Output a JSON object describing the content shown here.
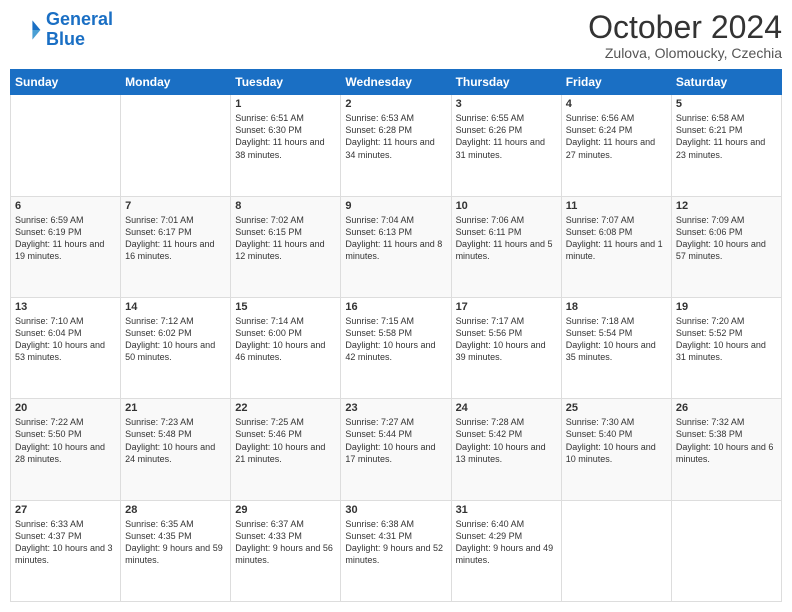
{
  "header": {
    "logo_line1": "General",
    "logo_line2": "Blue",
    "month": "October 2024",
    "location": "Zulova, Olomoucky, Czechia"
  },
  "days_of_week": [
    "Sunday",
    "Monday",
    "Tuesday",
    "Wednesday",
    "Thursday",
    "Friday",
    "Saturday"
  ],
  "weeks": [
    [
      {
        "day": "",
        "info": ""
      },
      {
        "day": "",
        "info": ""
      },
      {
        "day": "1",
        "info": "Sunrise: 6:51 AM\nSunset: 6:30 PM\nDaylight: 11 hours and 38 minutes."
      },
      {
        "day": "2",
        "info": "Sunrise: 6:53 AM\nSunset: 6:28 PM\nDaylight: 11 hours and 34 minutes."
      },
      {
        "day": "3",
        "info": "Sunrise: 6:55 AM\nSunset: 6:26 PM\nDaylight: 11 hours and 31 minutes."
      },
      {
        "day": "4",
        "info": "Sunrise: 6:56 AM\nSunset: 6:24 PM\nDaylight: 11 hours and 27 minutes."
      },
      {
        "day": "5",
        "info": "Sunrise: 6:58 AM\nSunset: 6:21 PM\nDaylight: 11 hours and 23 minutes."
      }
    ],
    [
      {
        "day": "6",
        "info": "Sunrise: 6:59 AM\nSunset: 6:19 PM\nDaylight: 11 hours and 19 minutes."
      },
      {
        "day": "7",
        "info": "Sunrise: 7:01 AM\nSunset: 6:17 PM\nDaylight: 11 hours and 16 minutes."
      },
      {
        "day": "8",
        "info": "Sunrise: 7:02 AM\nSunset: 6:15 PM\nDaylight: 11 hours and 12 minutes."
      },
      {
        "day": "9",
        "info": "Sunrise: 7:04 AM\nSunset: 6:13 PM\nDaylight: 11 hours and 8 minutes."
      },
      {
        "day": "10",
        "info": "Sunrise: 7:06 AM\nSunset: 6:11 PM\nDaylight: 11 hours and 5 minutes."
      },
      {
        "day": "11",
        "info": "Sunrise: 7:07 AM\nSunset: 6:08 PM\nDaylight: 11 hours and 1 minute."
      },
      {
        "day": "12",
        "info": "Sunrise: 7:09 AM\nSunset: 6:06 PM\nDaylight: 10 hours and 57 minutes."
      }
    ],
    [
      {
        "day": "13",
        "info": "Sunrise: 7:10 AM\nSunset: 6:04 PM\nDaylight: 10 hours and 53 minutes."
      },
      {
        "day": "14",
        "info": "Sunrise: 7:12 AM\nSunset: 6:02 PM\nDaylight: 10 hours and 50 minutes."
      },
      {
        "day": "15",
        "info": "Sunrise: 7:14 AM\nSunset: 6:00 PM\nDaylight: 10 hours and 46 minutes."
      },
      {
        "day": "16",
        "info": "Sunrise: 7:15 AM\nSunset: 5:58 PM\nDaylight: 10 hours and 42 minutes."
      },
      {
        "day": "17",
        "info": "Sunrise: 7:17 AM\nSunset: 5:56 PM\nDaylight: 10 hours and 39 minutes."
      },
      {
        "day": "18",
        "info": "Sunrise: 7:18 AM\nSunset: 5:54 PM\nDaylight: 10 hours and 35 minutes."
      },
      {
        "day": "19",
        "info": "Sunrise: 7:20 AM\nSunset: 5:52 PM\nDaylight: 10 hours and 31 minutes."
      }
    ],
    [
      {
        "day": "20",
        "info": "Sunrise: 7:22 AM\nSunset: 5:50 PM\nDaylight: 10 hours and 28 minutes."
      },
      {
        "day": "21",
        "info": "Sunrise: 7:23 AM\nSunset: 5:48 PM\nDaylight: 10 hours and 24 minutes."
      },
      {
        "day": "22",
        "info": "Sunrise: 7:25 AM\nSunset: 5:46 PM\nDaylight: 10 hours and 21 minutes."
      },
      {
        "day": "23",
        "info": "Sunrise: 7:27 AM\nSunset: 5:44 PM\nDaylight: 10 hours and 17 minutes."
      },
      {
        "day": "24",
        "info": "Sunrise: 7:28 AM\nSunset: 5:42 PM\nDaylight: 10 hours and 13 minutes."
      },
      {
        "day": "25",
        "info": "Sunrise: 7:30 AM\nSunset: 5:40 PM\nDaylight: 10 hours and 10 minutes."
      },
      {
        "day": "26",
        "info": "Sunrise: 7:32 AM\nSunset: 5:38 PM\nDaylight: 10 hours and 6 minutes."
      }
    ],
    [
      {
        "day": "27",
        "info": "Sunrise: 6:33 AM\nSunset: 4:37 PM\nDaylight: 10 hours and 3 minutes."
      },
      {
        "day": "28",
        "info": "Sunrise: 6:35 AM\nSunset: 4:35 PM\nDaylight: 9 hours and 59 minutes."
      },
      {
        "day": "29",
        "info": "Sunrise: 6:37 AM\nSunset: 4:33 PM\nDaylight: 9 hours and 56 minutes."
      },
      {
        "day": "30",
        "info": "Sunrise: 6:38 AM\nSunset: 4:31 PM\nDaylight: 9 hours and 52 minutes."
      },
      {
        "day": "31",
        "info": "Sunrise: 6:40 AM\nSunset: 4:29 PM\nDaylight: 9 hours and 49 minutes."
      },
      {
        "day": "",
        "info": ""
      },
      {
        "day": "",
        "info": ""
      }
    ]
  ]
}
